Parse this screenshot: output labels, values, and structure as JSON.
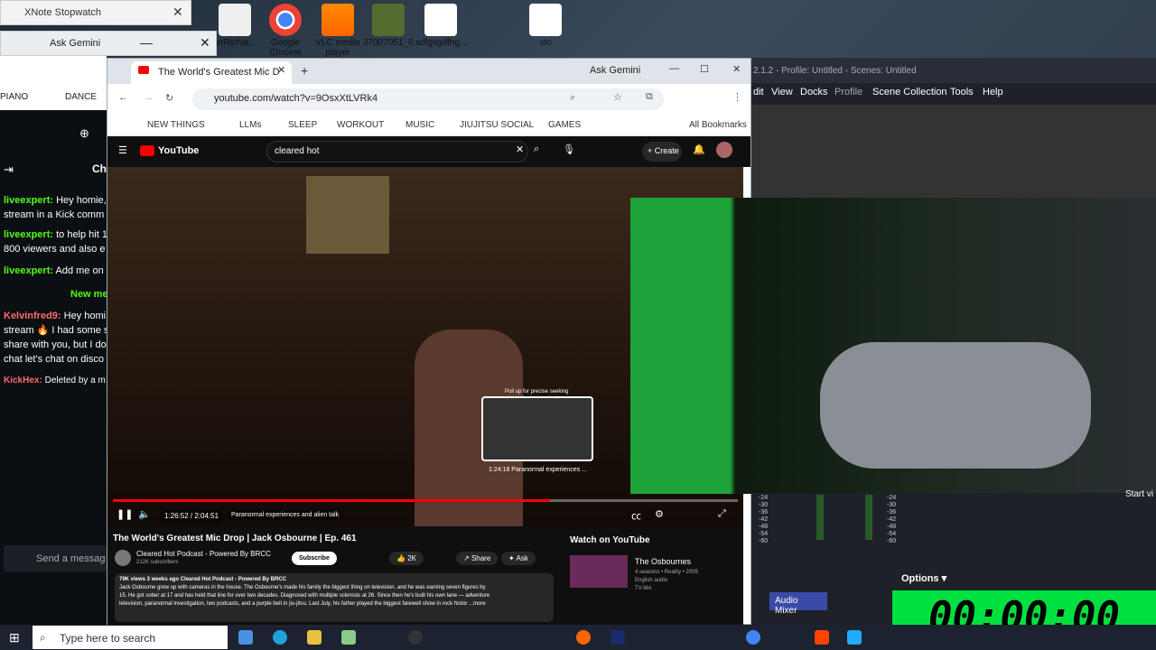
{
  "desktop": {
    "icons": [
      {
        "label": "anRichar..."
      },
      {
        "label": "Google Chrome"
      },
      {
        "label": "VLC media player"
      },
      {
        "label": "37007051_6..."
      },
      {
        "label": "sdfgsgdfhg..."
      },
      {
        "label": "sto"
      }
    ]
  },
  "xnote": {
    "title": "XNote Stopwatch"
  },
  "gemini_back": {
    "label": "Ask Gemini"
  },
  "chat": {
    "header": "Ch",
    "lines": [
      {
        "user": "liveexpert:",
        "text": "Hey homie,"
      },
      {
        "user": "",
        "text": "stream in a Kick comm"
      },
      {
        "user": "liveexpert:",
        "text": "to help hit 1"
      },
      {
        "user": "",
        "text": "800 viewers and also e"
      },
      {
        "user": "liveexpert:",
        "text": "Add me on"
      },
      {
        "user": "",
        "text": "New me"
      },
      {
        "user": "Kelvinfred9:",
        "text": "Hey homi"
      },
      {
        "user": "",
        "text": "stream 🔥 I had some s"
      },
      {
        "user": "",
        "text": "share with you, but I do"
      },
      {
        "user": "",
        "text": "chat let's chat on disco"
      },
      {
        "user": "KickHex:",
        "text": "Deleted by a m"
      }
    ],
    "send_placeholder": "Send a messag",
    "bookmarks": [
      "PIANO",
      "DANCE"
    ]
  },
  "browser": {
    "tab_title": "The World's Greatest Mic D",
    "gemini": "Ask Gemini",
    "url": "youtube.com/watch?v=9OsxXtLVRk4",
    "bookmarks": [
      "NEW THINGS",
      "LLMs",
      "SLEEP",
      "WORKOUT",
      "MUSIC",
      "JIUJITSU SOCIAL",
      "GAMES",
      "All Bookmarks"
    ]
  },
  "youtube": {
    "logo": "YouTube",
    "search": "cleared hot",
    "create": "Create",
    "time": "1:26:52 / 2:04:51",
    "chapter": "Paranormal experiences and alien talk",
    "hover_time": "1:24:18  Paranormal experiences ...",
    "hover_hint": "Pull up for precise seeking",
    "progress": 0.7,
    "title": "The World's Greatest Mic Drop | Jack Osbourne | Ep. 461",
    "channel": "Cleared Hot Podcast - Powered By BRCC",
    "subs": "212K subscribers",
    "subscribe": "Subscribe",
    "likes": "2K",
    "share": "Share",
    "ask": "Ask",
    "meta": "79K views  3 weeks ago  Cleared Hot Podcast - Powered By BRCC",
    "desc1": "Jack Osbourne grew up with cameras in the house. The Osbourne's made his family the biggest thing on television, and he was earning seven figures by",
    "desc2": "15. He got sober at 17 and has held that line for over two decades. Diagnosed with multiple sclerosis at 26. Since then he's built his own lane — adventure",
    "desc3": "television, paranormal investigation, two podcasts, and a purple belt in jiu-jitsu. Last July, his father played the biggest farewell show in rock histor ...more",
    "watch_on": "Watch on YouTube",
    "rec_title": "The Osbournes",
    "rec_meta": "4 seasons • Reality • 2005",
    "rec_meta2": "English audio",
    "rec_rating": "TV-MA"
  },
  "obs": {
    "title": "2.1.2 - Profile: Untitled - Scenes: Untitled",
    "menu": [
      "dit",
      "View",
      "Docks",
      "Profile",
      "Scene Collection",
      "Tools",
      "Help"
    ],
    "options": "Options",
    "audio_mixer": "Audio Mixer",
    "db_ticks": [
      "-24",
      "-30",
      "-36",
      "-42",
      "-48",
      "-54",
      "-60"
    ],
    "start": "Start vi"
  },
  "timer": "00:00:00",
  "taskbar": {
    "search": "Type here to search"
  }
}
